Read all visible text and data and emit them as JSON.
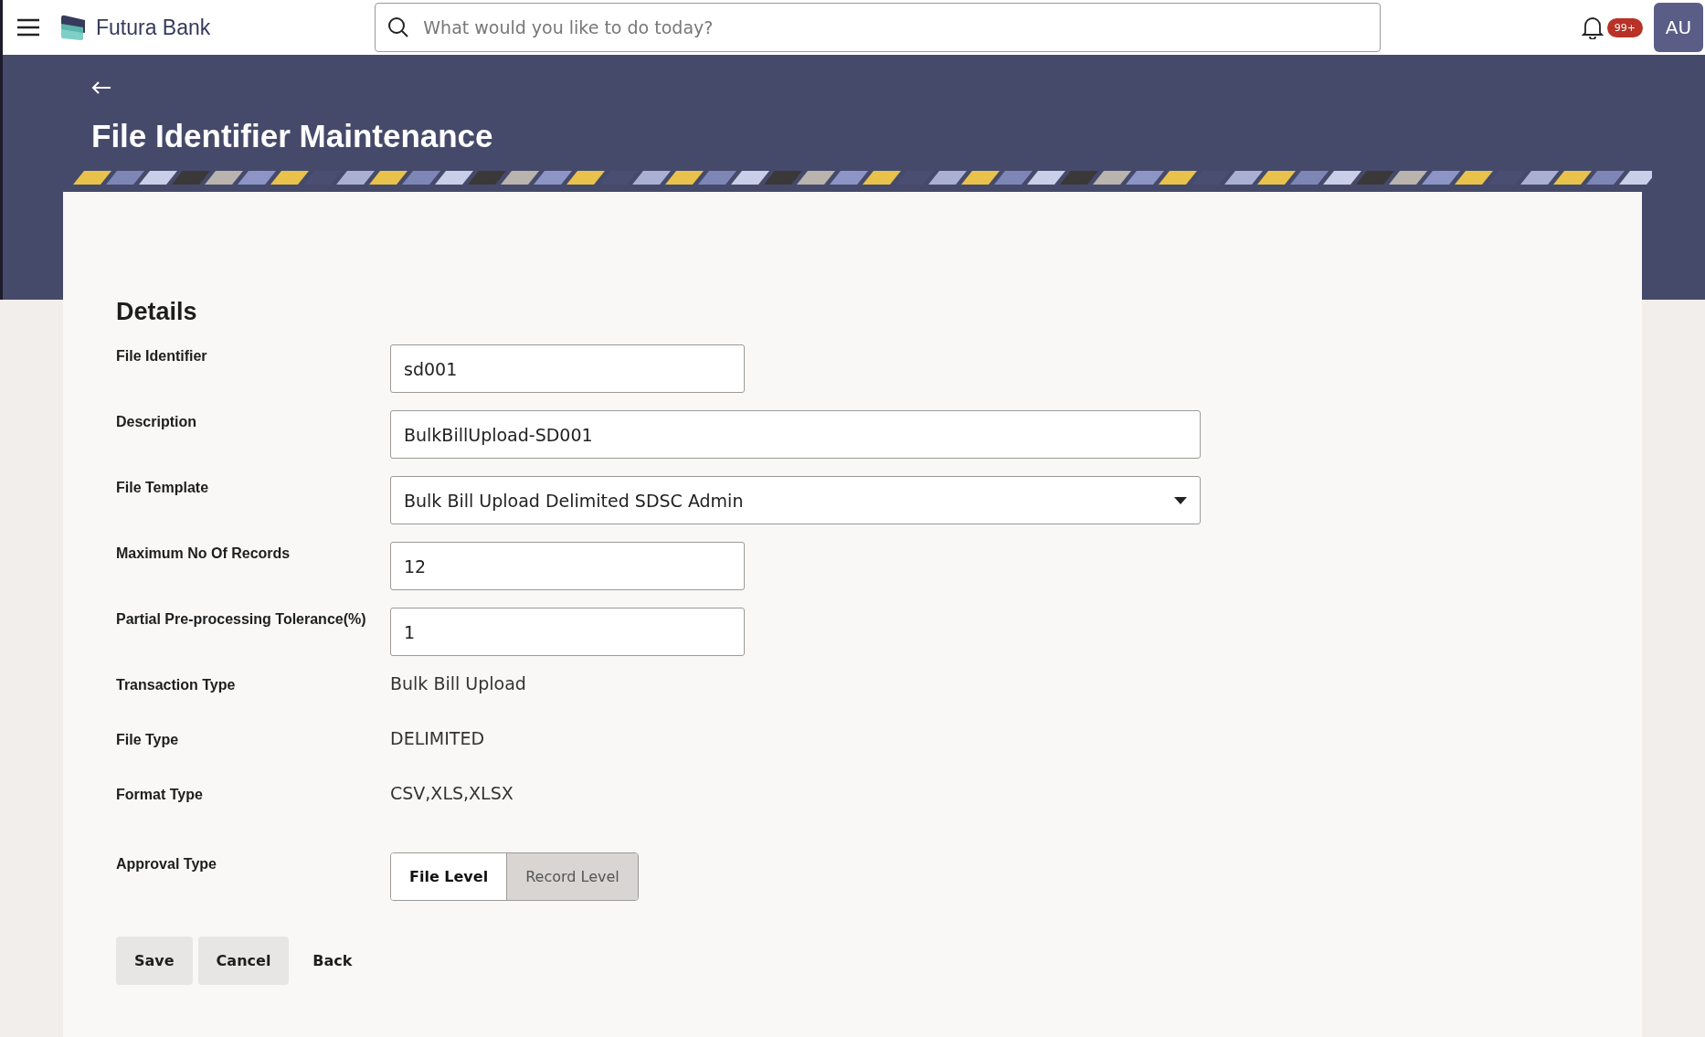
{
  "header": {
    "brand": "Futura Bank",
    "search": {
      "placeholder": "What would you like to do today?"
    },
    "notifications": {
      "badge": "99+"
    },
    "avatar": "AU"
  },
  "page": {
    "title": "File Identifier Maintenance"
  },
  "section": {
    "title": "Details"
  },
  "fields": [
    {
      "kind": "input",
      "label": "File Identifier",
      "value": "sd001",
      "wide": false
    },
    {
      "kind": "input",
      "label": "Description",
      "value": "BulkBillUpload-SD001",
      "wide": true
    },
    {
      "kind": "select",
      "label": "File Template",
      "value": "Bulk Bill Upload Delimited SDSC Admin",
      "wide": true
    },
    {
      "kind": "input",
      "label": "Maximum No Of Records",
      "value": "12",
      "wide": false
    },
    {
      "kind": "input",
      "label": "Partial Pre-processing Tolerance(%)",
      "value": "1",
      "wide": false
    },
    {
      "kind": "text",
      "label": "Transaction Type",
      "value": "Bulk Bill Upload"
    },
    {
      "kind": "text",
      "label": "File Type",
      "value": "DELIMITED"
    },
    {
      "kind": "text",
      "label": "Format Type",
      "value": "CSV,XLS,XLSX"
    },
    {
      "kind": "toggle",
      "label": "Approval Type",
      "options": [
        {
          "label": "File Level",
          "selected": true
        },
        {
          "label": "Record Level",
          "selected": false
        }
      ]
    }
  ],
  "buttons": [
    {
      "label": "Save",
      "kind": "filled"
    },
    {
      "label": "Cancel",
      "kind": "filled"
    },
    {
      "label": "Back",
      "kind": "link"
    }
  ]
}
